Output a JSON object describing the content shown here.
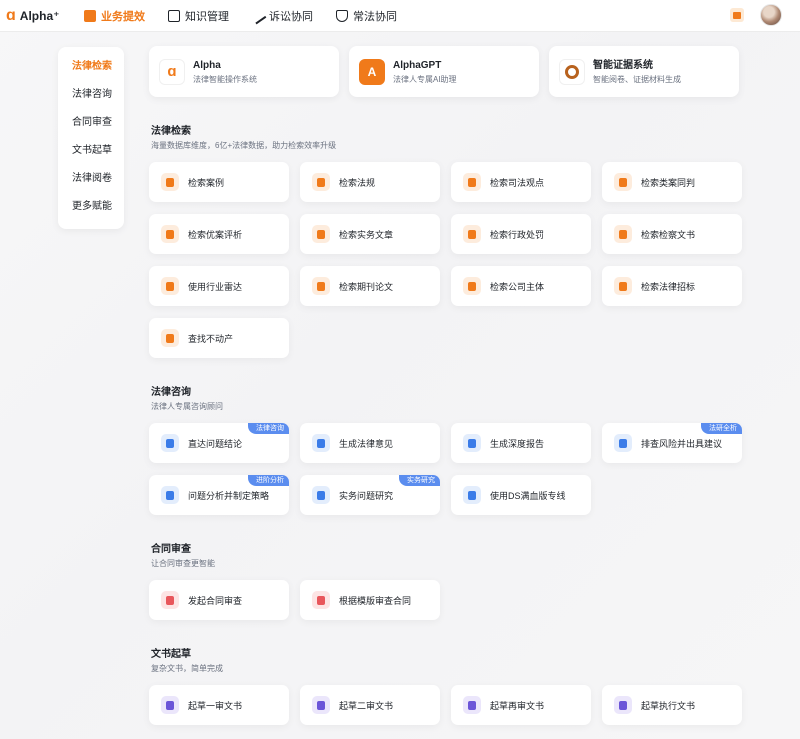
{
  "app": {
    "logo_text": "Alpha⁺",
    "logo_mark": "ɑ"
  },
  "nav": [
    {
      "label": "业务提效",
      "active": true
    },
    {
      "label": "知识管理",
      "active": false
    },
    {
      "label": "诉讼协同",
      "active": false
    },
    {
      "label": "常法协同",
      "active": false
    }
  ],
  "colors": {
    "accent": "#f07a1a",
    "badge": "#5b8def"
  },
  "sidebar": {
    "items": [
      {
        "label": "法律检索",
        "active": true
      },
      {
        "label": "法律咨询",
        "active": false
      },
      {
        "label": "合同审查",
        "active": false
      },
      {
        "label": "文书起草",
        "active": false
      },
      {
        "label": "法律阅卷",
        "active": false
      },
      {
        "label": "更多赋能",
        "active": false
      }
    ]
  },
  "products": [
    {
      "name": "Alpha",
      "desc": "法律智能操作系统"
    },
    {
      "name": "AlphaGPT",
      "desc": "法律人专属AI助理"
    },
    {
      "name": "智能证据系统",
      "desc": "智能阅卷、证据材料生成"
    }
  ],
  "sections": [
    {
      "title": "法律检索",
      "subtitle": "海量数据库维度，6亿+法律数据，助力检索效率升级",
      "tools": [
        {
          "label": "检索案例",
          "icon": "case-icon",
          "color": "orange"
        },
        {
          "label": "检索法规",
          "icon": "regulation-icon",
          "color": "orange"
        },
        {
          "label": "检索司法观点",
          "icon": "shield-icon",
          "color": "orange"
        },
        {
          "label": "检索类案同判",
          "icon": "document-icon",
          "color": "orange"
        },
        {
          "label": "检索优案评析",
          "icon": "image-icon",
          "color": "orange"
        },
        {
          "label": "检索实务文章",
          "icon": "clipboard-icon",
          "color": "orange"
        },
        {
          "label": "检索行政处罚",
          "icon": "gavel-icon",
          "color": "orange"
        },
        {
          "label": "检索检察文书",
          "icon": "book-icon",
          "color": "orange"
        },
        {
          "label": "使用行业雷达",
          "icon": "radar-icon",
          "color": "orange"
        },
        {
          "label": "检索期刊论文",
          "icon": "journal-icon",
          "color": "orange"
        },
        {
          "label": "检索公司主体",
          "icon": "company-icon",
          "color": "orange"
        },
        {
          "label": "检索法律招标",
          "icon": "bid-icon",
          "color": "orange"
        },
        {
          "label": "查找不动产",
          "icon": "location-icon",
          "color": "orange"
        }
      ]
    },
    {
      "title": "法律咨询",
      "subtitle": "法律人专属咨询顾问",
      "tools": [
        {
          "label": "直达问题结论",
          "icon": "answer-icon",
          "color": "blue",
          "badge": "法律咨询"
        },
        {
          "label": "生成法律意见",
          "icon": "opinion-icon",
          "color": "blue"
        },
        {
          "label": "生成深度报告",
          "icon": "report-icon",
          "color": "blue"
        },
        {
          "label": "排查风险并出具建议",
          "icon": "risk-icon",
          "color": "blue",
          "badge": "法研全析"
        },
        {
          "label": "问题分析并制定策略",
          "icon": "strategy-icon",
          "color": "blue",
          "badge": "进阶分析"
        },
        {
          "label": "实务问题研究",
          "icon": "research-icon",
          "color": "blue",
          "badge": "实务研究"
        },
        {
          "label": "使用DS满血版专线",
          "icon": "ds-icon",
          "color": "blue"
        }
      ]
    },
    {
      "title": "合同审查",
      "subtitle": "让合同审查更智能",
      "tools": [
        {
          "label": "发起合同审查",
          "icon": "contract-review-icon",
          "color": "red"
        },
        {
          "label": "根据模版审查合同",
          "icon": "template-review-icon",
          "color": "red"
        }
      ]
    },
    {
      "title": "文书起草",
      "subtitle": "复杂文书，简单完成",
      "tools": [
        {
          "label": "起草一审文书",
          "icon": "draft-first-icon",
          "color": "purple"
        },
        {
          "label": "起草二审文书",
          "icon": "draft-second-icon",
          "color": "purple"
        },
        {
          "label": "起草再审文书",
          "icon": "draft-retrial-icon",
          "color": "purple"
        },
        {
          "label": "起草执行文书",
          "icon": "draft-execution-icon",
          "color": "purple"
        }
      ]
    }
  ]
}
